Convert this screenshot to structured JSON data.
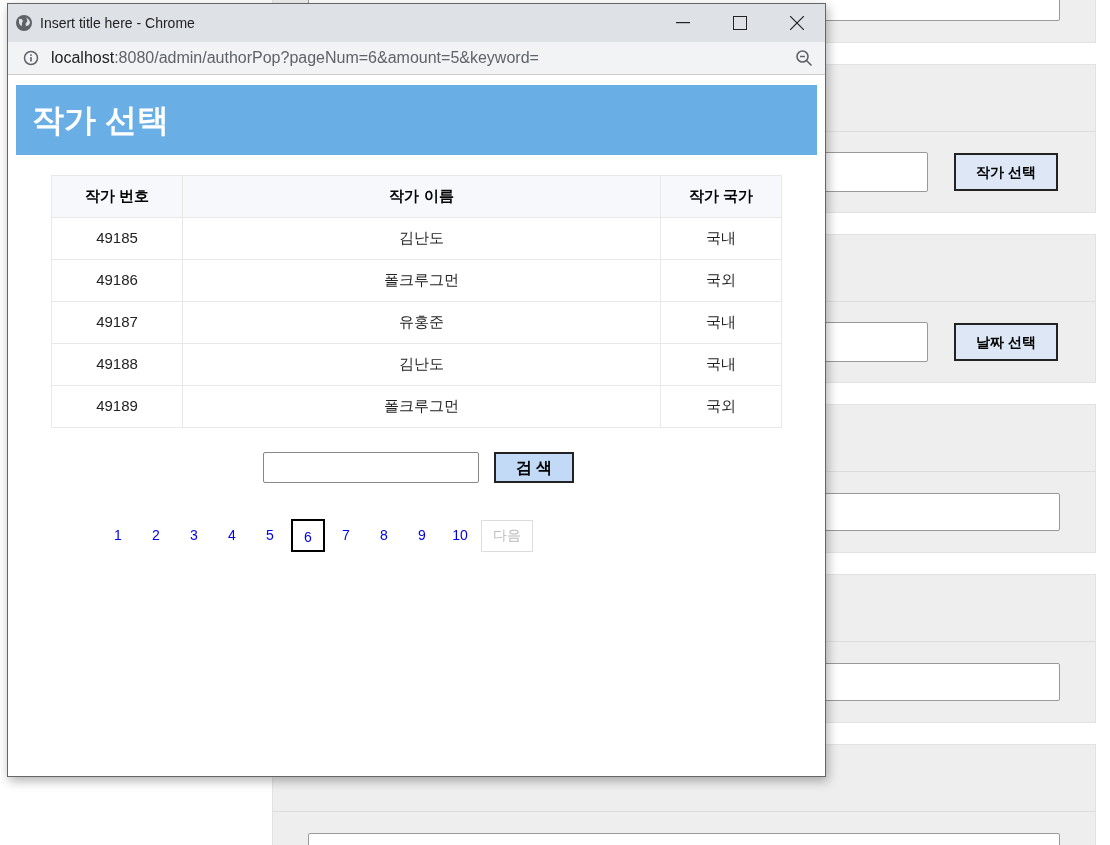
{
  "background_page": {
    "sections": [
      {
        "kind": "field"
      },
      {
        "kind": "field_button",
        "button": "작가 선택"
      },
      {
        "kind": "field_button",
        "button": "날짜 선택"
      },
      {
        "kind": "field"
      },
      {
        "kind": "field"
      },
      {
        "kind": "field"
      }
    ]
  },
  "popup": {
    "window": {
      "title": "Insert title here - Chrome"
    },
    "address_bar": {
      "host": "localhost",
      "path": ":8080/admin/authorPop?pageNum=6&amount=5&keyword="
    },
    "heading": "작가 선택",
    "table": {
      "columns": [
        "작가 번호",
        "작가 이름",
        "작가 국가"
      ],
      "rows": [
        [
          "49185",
          "김난도",
          "국내"
        ],
        [
          "49186",
          "폴크루그먼",
          "국외"
        ],
        [
          "49187",
          "유홍준",
          "국내"
        ],
        [
          "49188",
          "김난도",
          "국내"
        ],
        [
          "49189",
          "폴크루그먼",
          "국외"
        ]
      ]
    },
    "search": {
      "button": "검 색"
    },
    "pagination": {
      "pages": [
        {
          "label": "1",
          "selected": false
        },
        {
          "label": "2",
          "selected": false
        },
        {
          "label": "3",
          "selected": false
        },
        {
          "label": "4",
          "selected": false
        },
        {
          "label": "5",
          "selected": false
        },
        {
          "label": "6",
          "selected": true
        },
        {
          "label": "7",
          "selected": false
        },
        {
          "label": "8",
          "selected": false
        },
        {
          "label": "9",
          "selected": false
        },
        {
          "label": "10",
          "selected": false
        }
      ],
      "next": {
        "label": "다음",
        "disabled": true
      }
    }
  }
}
